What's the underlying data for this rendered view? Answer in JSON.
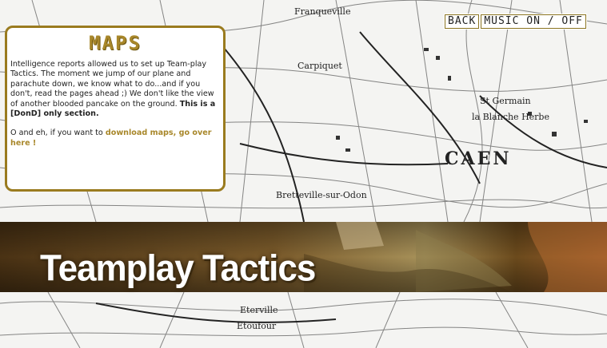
{
  "nav": {
    "back_label": "BACK",
    "music_label": "MUSIC ON / OFF"
  },
  "map_labels": {
    "franqueville": "Franqueville",
    "carpiquet": "Carpiquet",
    "caen": "CAEN",
    "st_germain": "St Germain",
    "blanche_herbe": "la Blanche Herbe",
    "bretteville": "Bretteville-sur-Odon",
    "eterville": "Eterville",
    "etoufour": "Etoufour"
  },
  "panel": {
    "title": "MAPS",
    "intro": "Intelligence reports allowed us to set up Team-play Tactics. The moment we jump of our plane and parachute down, we know what to do...and if you don't, read the pages ahead ;) We don't like the view of another blooded pancake on the ground. ",
    "intro_bold": "This is a [DonD] only section.",
    "download_prefix": "O and eh, if you want to ",
    "download_link": "download maps, go over here !"
  },
  "banner": {
    "title": "Teamplay Tactics"
  },
  "colors": {
    "accent": "#a8872a",
    "panel_border": "#9a7b1f",
    "banner_brown": "#5b3d17"
  }
}
